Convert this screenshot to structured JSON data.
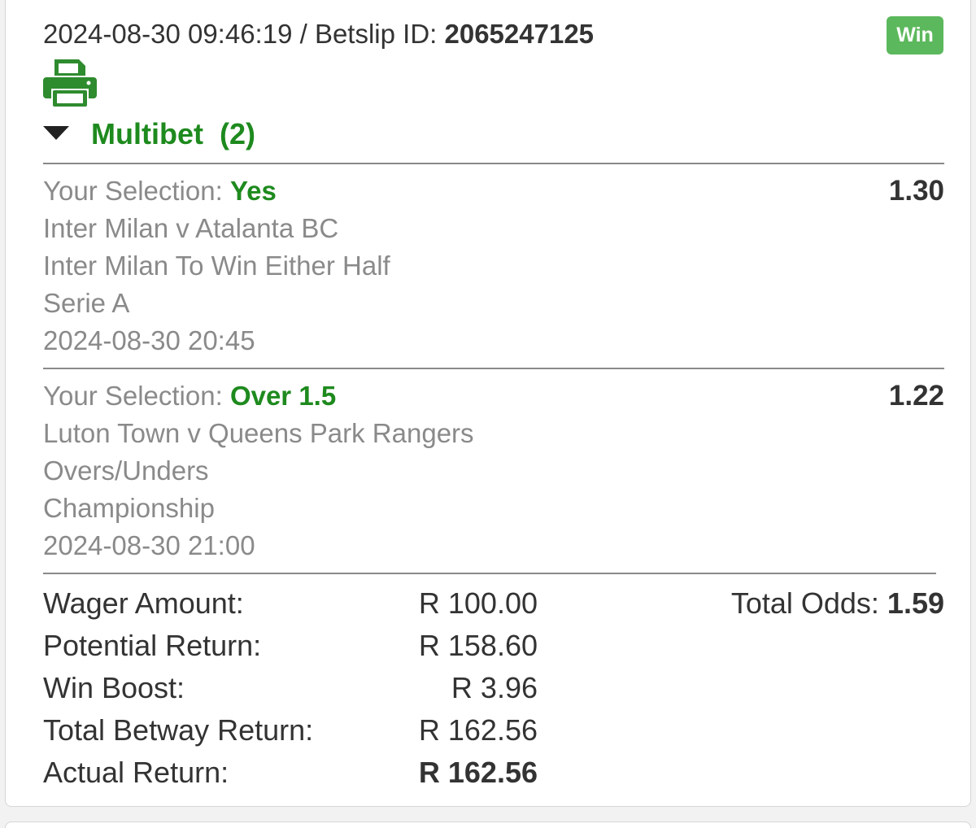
{
  "header": {
    "datetime": "2024-08-30 09:46:19",
    "separator": " / Betslip ID: ",
    "betslip_id": "2065247125",
    "status_badge": "Win"
  },
  "icons": {
    "print": "printer-icon",
    "toggle": "caret-down-icon"
  },
  "colors": {
    "accent_green": "#1e8a1e",
    "badge_green": "#5cb85c",
    "muted_text": "#8a8a8a",
    "dark_text": "#333333"
  },
  "multibet": {
    "label": "Multibet  (2)"
  },
  "legs": [
    {
      "selection_label": "Your Selection: ",
      "selection_value": "Yes",
      "odds": "1.30",
      "event": "Inter Milan v Atalanta BC",
      "market": "Inter Milan To Win Either Half",
      "league": "Serie A",
      "kickoff": "2024-08-30 20:45"
    },
    {
      "selection_label": "Your Selection: ",
      "selection_value": "Over 1.5",
      "odds": "1.22",
      "event": "Luton Town v Queens Park Rangers",
      "market": "Overs/Unders",
      "league": "Championship",
      "kickoff": "2024-08-30 21:00"
    }
  ],
  "summary": {
    "wager_label": "Wager Amount:",
    "wager_value": "R 100.00",
    "potential_label": "Potential Return:",
    "potential_value": "R 158.60",
    "boost_label": "Win Boost:",
    "boost_value": "R 3.96",
    "betway_label": "Total Betway Return:",
    "betway_value": "R 162.56",
    "actual_label": "Actual Return:",
    "actual_value": "R 162.56",
    "total_odds_label": "Total Odds: ",
    "total_odds_value": "1.59"
  }
}
